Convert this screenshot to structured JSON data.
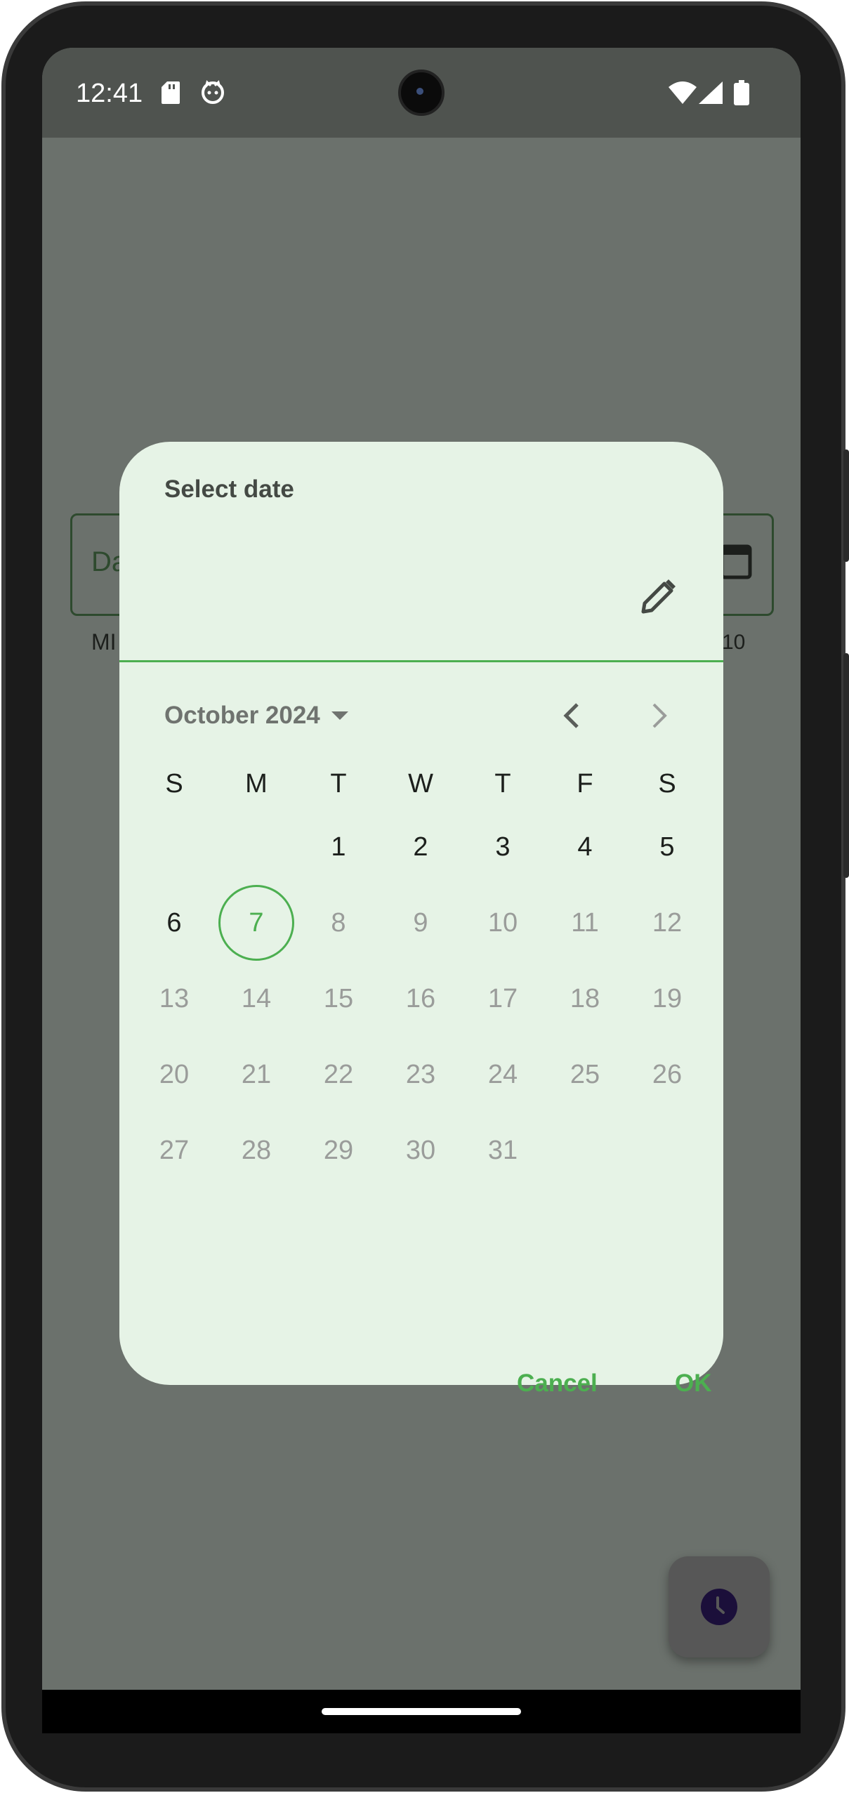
{
  "status_bar": {
    "time": "12:41"
  },
  "background_screen": {
    "field_label": "Da",
    "helper_left": "MI",
    "helper_right": "10"
  },
  "dialog": {
    "title": "Select date",
    "month_year": "October 2024",
    "weekdays": [
      "S",
      "M",
      "T",
      "W",
      "T",
      "F",
      "S"
    ],
    "weeks": [
      [
        "",
        "",
        "1",
        "2",
        "3",
        "4",
        "5"
      ],
      [
        "6",
        "7",
        "8",
        "9",
        "10",
        "11",
        "12"
      ],
      [
        "13",
        "14",
        "15",
        "16",
        "17",
        "18",
        "19"
      ],
      [
        "20",
        "21",
        "22",
        "23",
        "24",
        "25",
        "26"
      ],
      [
        "27",
        "28",
        "29",
        "30",
        "31",
        "",
        ""
      ]
    ],
    "today": "7",
    "cancel_label": "Cancel",
    "ok_label": "OK"
  },
  "colors": {
    "accent": "#4caf50",
    "dialog_bg": "#e6f3e6",
    "scrim": "#6b716c"
  },
  "icons": [
    "sd-card-icon",
    "cat-icon",
    "wifi-icon",
    "signal-icon",
    "battery-icon",
    "calendar-icon",
    "edit-icon",
    "dropdown-arrow-icon",
    "chevron-left-icon",
    "chevron-right-icon",
    "clock-icon"
  ]
}
